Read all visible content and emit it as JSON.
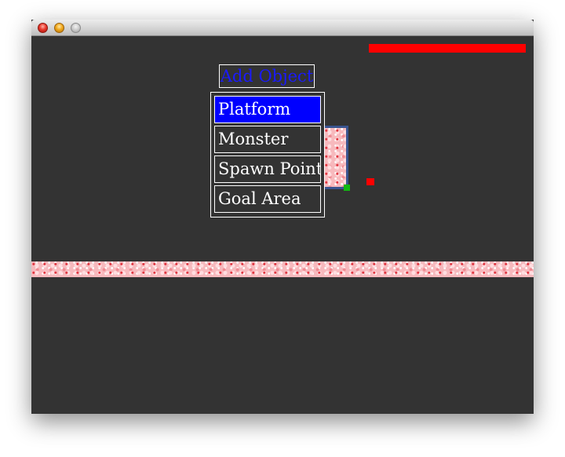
{
  "window": {
    "title": "",
    "controls": [
      "close-button",
      "minimize-button",
      "zoom-button"
    ]
  },
  "hud": {
    "health_fraction": 1.0,
    "health_color": "#ff0000"
  },
  "add_object_menu": {
    "title": "Add Object",
    "title_color": "#1a1aff",
    "items": [
      {
        "label": "Platform",
        "selected": true
      },
      {
        "label": "Monster",
        "selected": false
      },
      {
        "label": "Spawn Point",
        "selected": false
      },
      {
        "label": "Goal Area",
        "selected": false
      }
    ],
    "selected_color": "#0000ff"
  },
  "scene": {
    "background": "#333333",
    "selection_outline_color": "#3a5590",
    "resize_handle_color": "#12b812",
    "marker_color": "#ff0000",
    "platform_texture": "pink-marble"
  }
}
